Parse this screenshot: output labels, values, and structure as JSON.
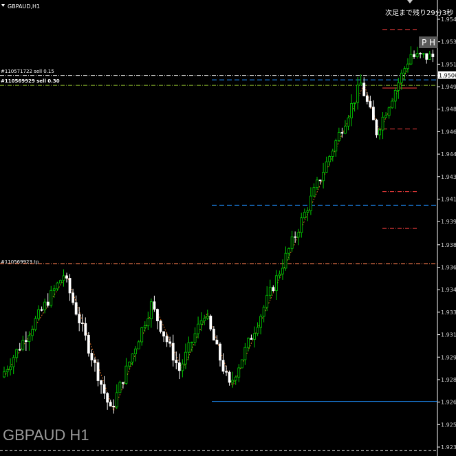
{
  "window": {
    "title": "GBPAUD,H1",
    "watermark": "GBPAUD H1",
    "countdown": "次足まで残り29分3秒",
    "ph_button": "P H"
  },
  "price_axis": {
    "labels": [
      "1.95475",
      "1.95310",
      "1.95145",
      "1.94980",
      "1.94815",
      "1.94650",
      "1.94485",
      "1.94320",
      "1.94155",
      "1.93990",
      "1.93820",
      "1.93655",
      "1.93490",
      "1.93325",
      "1.93160",
      "1.92995",
      "1.92830",
      "1.92665",
      "1.92500",
      "1.92335"
    ],
    "current_price": "1.95063"
  },
  "orders": [
    {
      "label": "#110571722 sell 0.15",
      "color": "#ffffff",
      "style": "dashdot"
    },
    {
      "label": "#110569929 sell 0.30",
      "color": "#9acd32",
      "style": "dashdot"
    },
    {
      "label": "#110569923 tp",
      "color": "#ff7f50",
      "style": "dashdot"
    }
  ],
  "colors": {
    "background": "#000000",
    "bull_candle": "#00cc00",
    "bear_candle": "#ffffff",
    "zigzag": "#d2691e",
    "blue_line": "#1e90ff",
    "red_levels": "#ff4040",
    "axis_text": "#d0d0d0"
  },
  "chart_data": {
    "type": "candlestick",
    "symbol": "GBPAUD",
    "timeframe": "H1",
    "y_axis": {
      "min": 1.92335,
      "max": 1.95475,
      "unit": "price"
    },
    "zigzag": [
      {
        "bar": 0,
        "price": 1.9285
      },
      {
        "bar": 20,
        "price": 1.936
      },
      {
        "bar": 35,
        "price": 1.926
      },
      {
        "bar": 48,
        "price": 1.9338
      },
      {
        "bar": 57,
        "price": 1.929
      },
      {
        "bar": 65,
        "price": 1.9332
      },
      {
        "bar": 73,
        "price": 1.9278
      },
      {
        "bar": 115,
        "price": 1.95
      },
      {
        "bar": 120,
        "price": 1.9465
      },
      {
        "bar": 131,
        "price": 1.9522
      }
    ],
    "levels": [
      {
        "price": 1.95063,
        "color": "#ffffff",
        "style": "dashdot",
        "label_ref": 0
      },
      {
        "price": 1.9499,
        "color": "#9acd32",
        "style": "dashdot",
        "label_ref": 1
      },
      {
        "price": 1.9368,
        "color": "#ff7f50",
        "style": "dashdot",
        "label_ref": 2
      },
      {
        "price": 1.9503,
        "color": "#1e90ff",
        "style": "dashed"
      },
      {
        "price": 1.9411,
        "color": "#1e90ff",
        "style": "dashed"
      },
      {
        "price": 1.9267,
        "color": "#1e90ff",
        "style": "solid"
      }
    ],
    "right_levels": [
      {
        "price": 1.954,
        "color": "#ff4040",
        "style": "dashed"
      },
      {
        "price": 1.9497,
        "color": "#ff4040",
        "style": "solid"
      },
      {
        "price": 1.9467,
        "color": "#ff4040",
        "style": "dashed"
      },
      {
        "price": 1.9421,
        "color": "#ff4040",
        "style": "dashdot"
      },
      {
        "price": 1.9394,
        "color": "#ff4040",
        "style": "dashdot"
      }
    ]
  }
}
